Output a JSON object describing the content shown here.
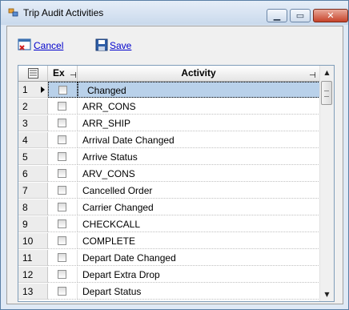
{
  "window": {
    "title": "Trip Audit Activities"
  },
  "toolbar": {
    "cancel_label": "Cancel",
    "save_label": "Save"
  },
  "grid": {
    "columns": {
      "ex": "Ex",
      "activity": "Activity"
    },
    "rows": [
      {
        "num": "1",
        "activity": "Changed",
        "checked": false,
        "selected": true
      },
      {
        "num": "2",
        "activity": "ARR_CONS",
        "checked": false
      },
      {
        "num": "3",
        "activity": "ARR_SHIP",
        "checked": false
      },
      {
        "num": "4",
        "activity": "Arrival Date Changed",
        "checked": false
      },
      {
        "num": "5",
        "activity": "Arrive Status",
        "checked": false
      },
      {
        "num": "6",
        "activity": "ARV_CONS",
        "checked": false
      },
      {
        "num": "7",
        "activity": "Cancelled Order",
        "checked": false
      },
      {
        "num": "8",
        "activity": "Carrier Changed",
        "checked": false
      },
      {
        "num": "9",
        "activity": "CHECKCALL",
        "checked": false
      },
      {
        "num": "10",
        "activity": "COMPLETE",
        "checked": false
      },
      {
        "num": "11",
        "activity": "Depart Date Changed",
        "checked": false
      },
      {
        "num": "12",
        "activity": "Depart Extra Drop",
        "checked": false
      },
      {
        "num": "13",
        "activity": "Depart Status",
        "checked": false
      }
    ]
  }
}
